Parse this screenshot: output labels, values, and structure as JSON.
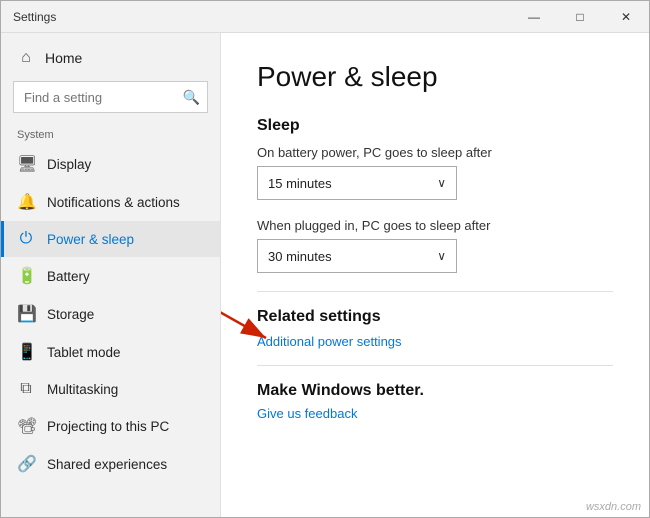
{
  "window": {
    "title": "Settings",
    "controls": {
      "minimize": "—",
      "maximize": "□",
      "close": "✕"
    }
  },
  "sidebar": {
    "home_label": "Home",
    "search_placeholder": "Find a setting",
    "section_label": "System",
    "items": [
      {
        "id": "display",
        "label": "Display",
        "icon": "🖥"
      },
      {
        "id": "notifications",
        "label": "Notifications & actions",
        "icon": "🔔"
      },
      {
        "id": "power",
        "label": "Power & sleep",
        "icon": "⏻",
        "active": true
      },
      {
        "id": "battery",
        "label": "Battery",
        "icon": "🔋"
      },
      {
        "id": "storage",
        "label": "Storage",
        "icon": "💾"
      },
      {
        "id": "tablet",
        "label": "Tablet mode",
        "icon": "📱"
      },
      {
        "id": "multitasking",
        "label": "Multitasking",
        "icon": "⧉"
      },
      {
        "id": "projecting",
        "label": "Projecting to this PC",
        "icon": "📽"
      },
      {
        "id": "shared",
        "label": "Shared experiences",
        "icon": "🔗"
      }
    ]
  },
  "main": {
    "page_title": "Power & sleep",
    "sleep_section": {
      "title": "Sleep",
      "battery_label": "On battery power, PC goes to sleep after",
      "battery_value": "15 minutes",
      "plugged_label": "When plugged in, PC goes to sleep after",
      "plugged_value": "30 minutes"
    },
    "related_section": {
      "title": "Related settings",
      "link_label": "Additional power settings"
    },
    "make_better_section": {
      "title": "Make Windows better.",
      "link_label": "Give us feedback"
    }
  },
  "watermark": "wsxdn.com"
}
